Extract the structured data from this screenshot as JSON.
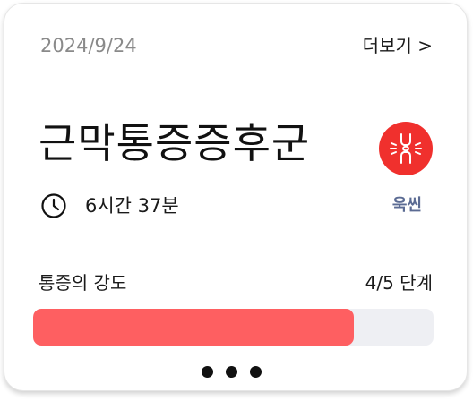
{
  "header": {
    "date": "2024/9/24",
    "more_label": "더보기 >"
  },
  "condition": {
    "title": "근막통증증후군",
    "body_icon": "body-joint-icon",
    "icon_color": "#f0302d"
  },
  "duration": {
    "icon": "clock-icon",
    "text": "6시간 37분"
  },
  "location": {
    "text": "욱씬",
    "color": "#5b6b93"
  },
  "intensity": {
    "label": "통증의 강도",
    "value_text": "4/5 단계",
    "level": 4,
    "max": 5,
    "fill_color": "#fe5f61",
    "track_color": "#eeeff3"
  },
  "pager": {
    "icon": "more-dots-icon",
    "dot_count": 3
  }
}
